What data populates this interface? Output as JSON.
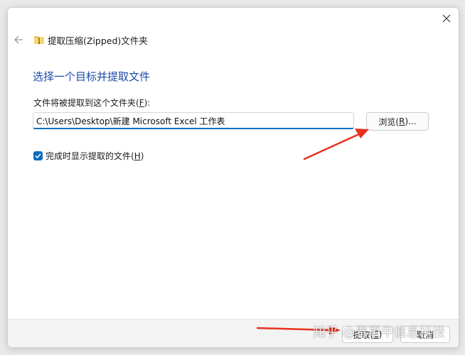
{
  "window": {
    "title": "提取压缩(Zipped)文件夹",
    "close_icon": "close-icon",
    "back_icon": "back-arrow-icon",
    "folder_icon": "zip-folder-icon"
  },
  "content": {
    "heading": "选择一个目标并提取文件",
    "field_label_prefix": "文件将被提取到这个文件夹(",
    "field_label_key": "F",
    "field_label_suffix": "):",
    "path_value": "C:\\Users\\Desktop\\新建 Microsoft Excel 工作表",
    "browse_prefix": "浏览(",
    "browse_key": "R",
    "browse_suffix": ")...",
    "checkbox_checked": true,
    "checkbox_prefix": "完成时显示提取的文件(",
    "checkbox_key": "H",
    "checkbox_suffix": ")"
  },
  "footer": {
    "extract_prefix": "提取(",
    "extract_key": "E",
    "extract_suffix": ")",
    "cancel_label": "取消"
  },
  "overlay": {
    "watermark": "知乎 @春事牛信息科技",
    "annotation_color": "#e8311f"
  },
  "colors": {
    "accent": "#0f6cbd",
    "heading": "#1b4aa8"
  }
}
